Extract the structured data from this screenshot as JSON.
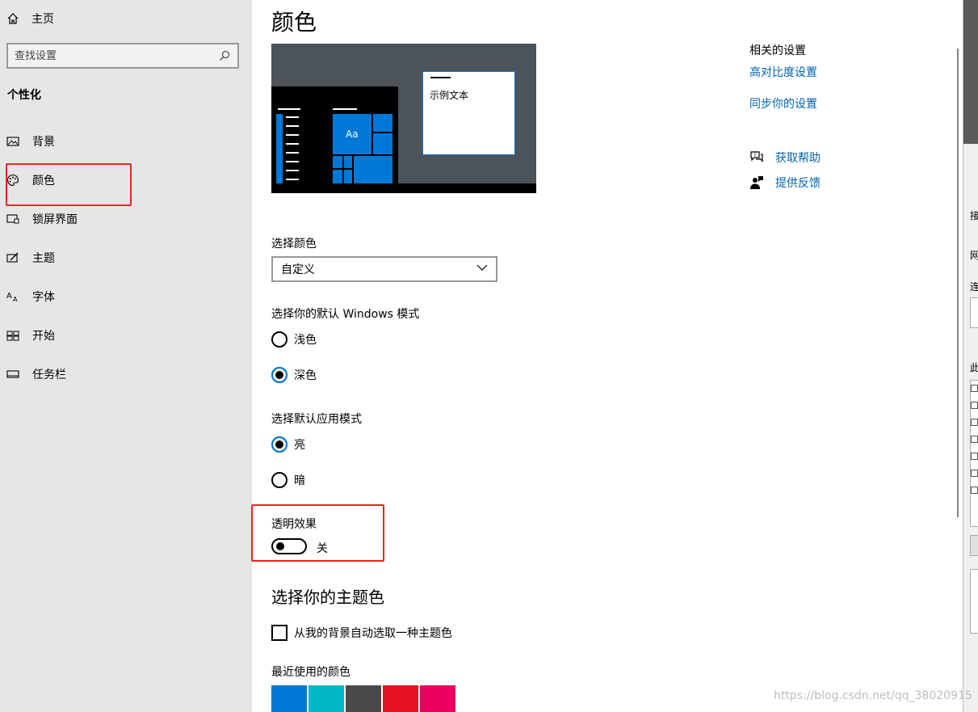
{
  "sidebar": {
    "home_label": "主页",
    "search_placeholder": "查找设置",
    "section_title": "个性化",
    "items": [
      {
        "label": "背景",
        "icon": "image-icon"
      },
      {
        "label": "颜色",
        "icon": "palette-icon"
      },
      {
        "label": "锁屏界面",
        "icon": "lock-screen-icon"
      },
      {
        "label": "主题",
        "icon": "theme-icon"
      },
      {
        "label": "字体",
        "icon": "font-icon"
      },
      {
        "label": "开始",
        "icon": "start-icon"
      },
      {
        "label": "任务栏",
        "icon": "taskbar-icon"
      }
    ],
    "selected_item": "颜色"
  },
  "main": {
    "title": "颜色",
    "preview": {
      "sample_text": "示例文本",
      "tile_text": "Aa"
    },
    "choose_color": {
      "label": "选择颜色",
      "value": "自定义"
    },
    "windows_mode": {
      "label": "选择你的默认 Windows 模式",
      "options": [
        "浅色",
        "深色"
      ],
      "selected": "深色"
    },
    "app_mode": {
      "label": "选择默认应用模式",
      "options": [
        "亮",
        "暗"
      ],
      "selected": "亮"
    },
    "transparency": {
      "label": "透明效果",
      "state": "关",
      "on": false
    },
    "accent": {
      "heading": "选择你的主题色",
      "auto_pick_label": "从我的背景自动选取一种主题色",
      "auto_pick_checked": false,
      "recent_label": "最近使用的颜色",
      "recent_colors": [
        "#0078d7",
        "#00b7c3",
        "#4c4a48",
        "#e81123",
        "#ea005e"
      ]
    }
  },
  "related": {
    "title": "相关的设置",
    "links": [
      "高对比度设置",
      "同步你的设置"
    ],
    "help": [
      {
        "label": "获取帮助",
        "icon": "help-chat-icon"
      },
      {
        "label": "提供反馈",
        "icon": "feedback-icon"
      }
    ]
  },
  "background_window": {
    "fragments": [
      "接",
      "网络",
      "连",
      "此"
    ]
  },
  "watermark": "https://blog.csdn.net/qq_38020915",
  "colors": {
    "accent": "#0078d7",
    "link": "#0063b1",
    "highlight_box": "#e8261f",
    "sidebar_bg": "#e6e6e6"
  }
}
